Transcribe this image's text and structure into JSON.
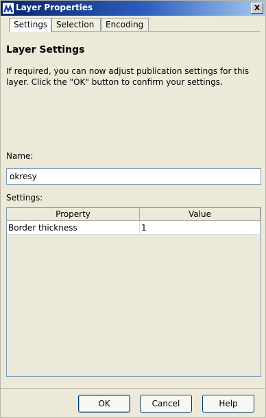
{
  "window": {
    "title": "Layer Properties",
    "close_label": "X"
  },
  "tabs": [
    {
      "label": "Settings",
      "active": true
    },
    {
      "label": "Selection",
      "active": false
    },
    {
      "label": "Encoding",
      "active": false
    }
  ],
  "content": {
    "heading": "Layer Settings",
    "description": "If required, you can now adjust publication settings for this layer. Click the \"OK\" button to confirm your settings.",
    "name_label": "Name:",
    "name_value": "okresy",
    "settings_label": "Settings:"
  },
  "table": {
    "columns": [
      "Property",
      "Value"
    ],
    "rows": [
      {
        "property": "Border thickness",
        "value": "1"
      }
    ]
  },
  "buttons": {
    "ok": "OK",
    "cancel": "Cancel",
    "help": "Help"
  },
  "colors": {
    "title_start": "#0a246a",
    "title_end": "#a6caf0",
    "dialog_bg": "#ece9d8",
    "input_border": "#7f9db9"
  },
  "icons": {
    "app": "app-logo-icon",
    "close": "close-icon"
  }
}
